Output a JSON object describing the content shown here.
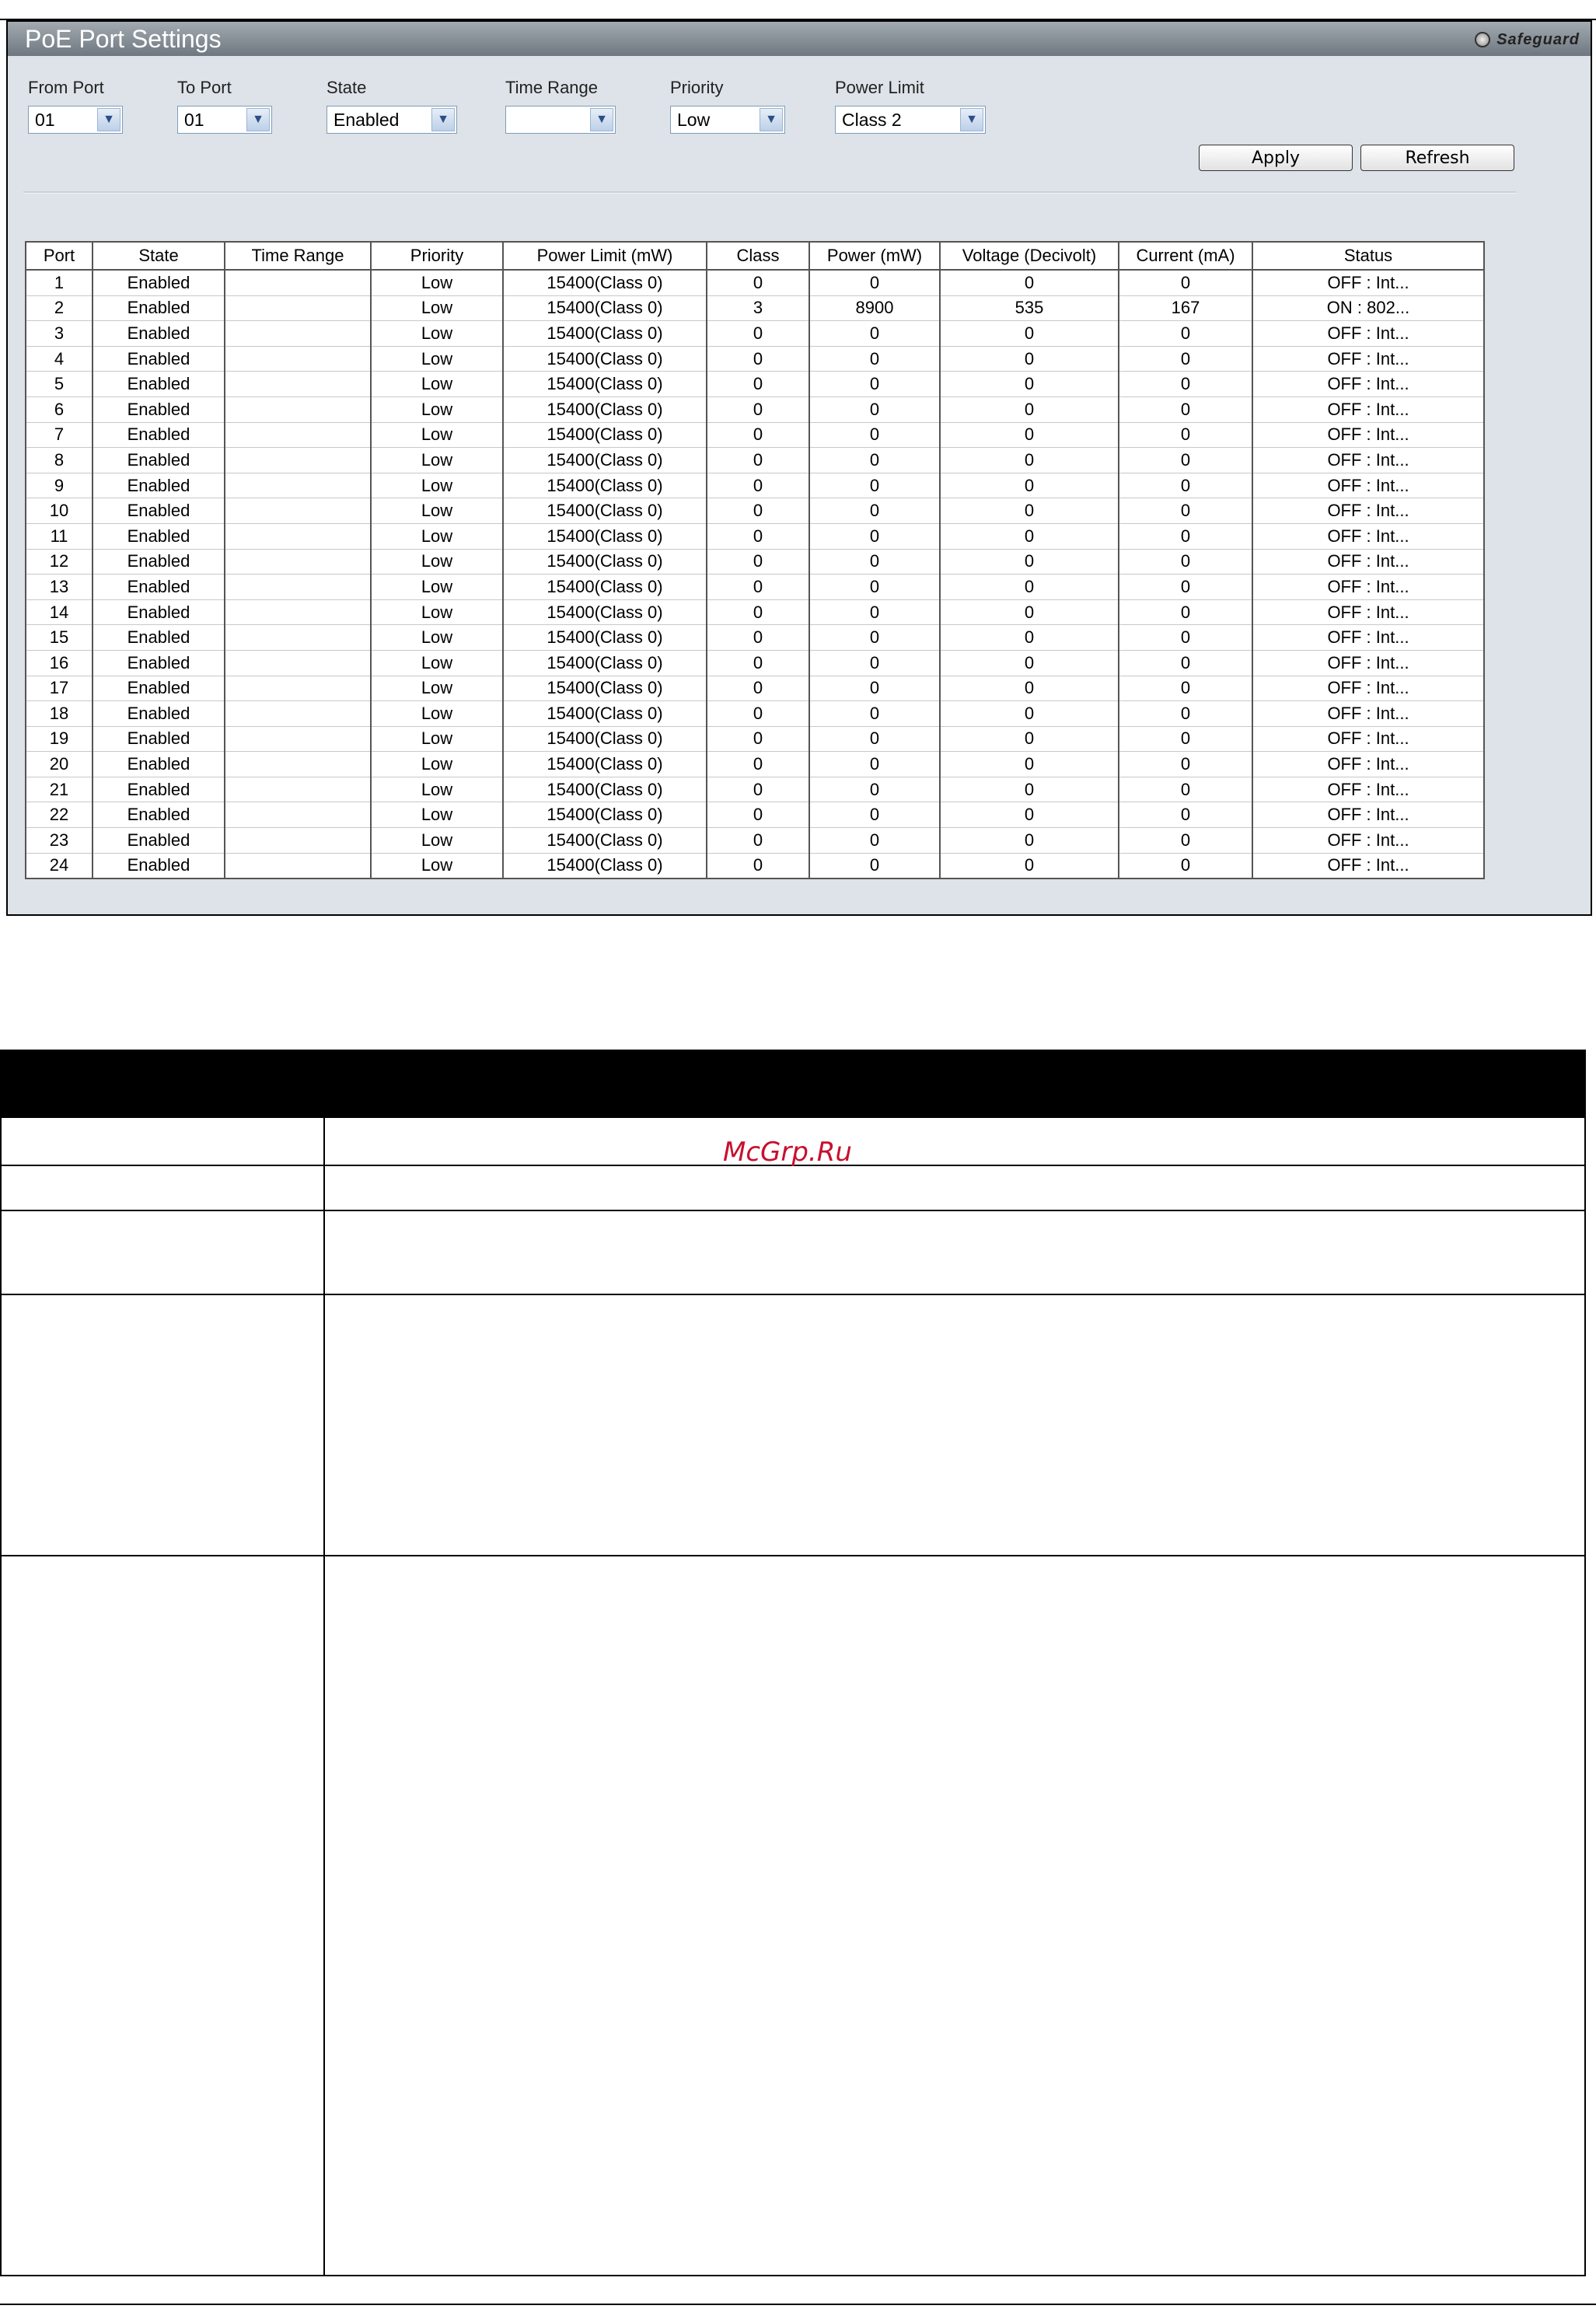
{
  "window": {
    "title": "PoE Port Settings",
    "badge": "Safeguard"
  },
  "form": {
    "from_port": {
      "label": "From Port",
      "value": "01"
    },
    "to_port": {
      "label": "To Port",
      "value": "01"
    },
    "state": {
      "label": "State",
      "value": "Enabled"
    },
    "time_range": {
      "label": "Time Range",
      "value": ""
    },
    "priority": {
      "label": "Priority",
      "value": "Low"
    },
    "power_limit": {
      "label": "Power Limit",
      "value": "Class 2"
    },
    "apply_label": "Apply",
    "refresh_label": "Refresh"
  },
  "table": {
    "headers": [
      "Port",
      "State",
      "Time Range",
      "Priority",
      "Power Limit (mW)",
      "Class",
      "Power (mW)",
      "Voltage (Decivolt)",
      "Current (mA)",
      "Status"
    ],
    "rows": [
      [
        "1",
        "Enabled",
        "",
        "Low",
        "15400(Class 0)",
        "0",
        "0",
        "0",
        "0",
        "OFF : Int..."
      ],
      [
        "2",
        "Enabled",
        "",
        "Low",
        "15400(Class 0)",
        "3",
        "8900",
        "535",
        "167",
        "ON : 802..."
      ],
      [
        "3",
        "Enabled",
        "",
        "Low",
        "15400(Class 0)",
        "0",
        "0",
        "0",
        "0",
        "OFF : Int..."
      ],
      [
        "4",
        "Enabled",
        "",
        "Low",
        "15400(Class 0)",
        "0",
        "0",
        "0",
        "0",
        "OFF : Int..."
      ],
      [
        "5",
        "Enabled",
        "",
        "Low",
        "15400(Class 0)",
        "0",
        "0",
        "0",
        "0",
        "OFF : Int..."
      ],
      [
        "6",
        "Enabled",
        "",
        "Low",
        "15400(Class 0)",
        "0",
        "0",
        "0",
        "0",
        "OFF : Int..."
      ],
      [
        "7",
        "Enabled",
        "",
        "Low",
        "15400(Class 0)",
        "0",
        "0",
        "0",
        "0",
        "OFF : Int..."
      ],
      [
        "8",
        "Enabled",
        "",
        "Low",
        "15400(Class 0)",
        "0",
        "0",
        "0",
        "0",
        "OFF : Int..."
      ],
      [
        "9",
        "Enabled",
        "",
        "Low",
        "15400(Class 0)",
        "0",
        "0",
        "0",
        "0",
        "OFF : Int..."
      ],
      [
        "10",
        "Enabled",
        "",
        "Low",
        "15400(Class 0)",
        "0",
        "0",
        "0",
        "0",
        "OFF : Int..."
      ],
      [
        "11",
        "Enabled",
        "",
        "Low",
        "15400(Class 0)",
        "0",
        "0",
        "0",
        "0",
        "OFF : Int..."
      ],
      [
        "12",
        "Enabled",
        "",
        "Low",
        "15400(Class 0)",
        "0",
        "0",
        "0",
        "0",
        "OFF : Int..."
      ],
      [
        "13",
        "Enabled",
        "",
        "Low",
        "15400(Class 0)",
        "0",
        "0",
        "0",
        "0",
        "OFF : Int..."
      ],
      [
        "14",
        "Enabled",
        "",
        "Low",
        "15400(Class 0)",
        "0",
        "0",
        "0",
        "0",
        "OFF : Int..."
      ],
      [
        "15",
        "Enabled",
        "",
        "Low",
        "15400(Class 0)",
        "0",
        "0",
        "0",
        "0",
        "OFF : Int..."
      ],
      [
        "16",
        "Enabled",
        "",
        "Low",
        "15400(Class 0)",
        "0",
        "0",
        "0",
        "0",
        "OFF : Int..."
      ],
      [
        "17",
        "Enabled",
        "",
        "Low",
        "15400(Class 0)",
        "0",
        "0",
        "0",
        "0",
        "OFF : Int..."
      ],
      [
        "18",
        "Enabled",
        "",
        "Low",
        "15400(Class 0)",
        "0",
        "0",
        "0",
        "0",
        "OFF : Int..."
      ],
      [
        "19",
        "Enabled",
        "",
        "Low",
        "15400(Class 0)",
        "0",
        "0",
        "0",
        "0",
        "OFF : Int..."
      ],
      [
        "20",
        "Enabled",
        "",
        "Low",
        "15400(Class 0)",
        "0",
        "0",
        "0",
        "0",
        "OFF : Int..."
      ],
      [
        "21",
        "Enabled",
        "",
        "Low",
        "15400(Class 0)",
        "0",
        "0",
        "0",
        "0",
        "OFF : Int..."
      ],
      [
        "22",
        "Enabled",
        "",
        "Low",
        "15400(Class 0)",
        "0",
        "0",
        "0",
        "0",
        "OFF : Int..."
      ],
      [
        "23",
        "Enabled",
        "",
        "Low",
        "15400(Class 0)",
        "0",
        "0",
        "0",
        "0",
        "OFF : Int..."
      ],
      [
        "24",
        "Enabled",
        "",
        "Low",
        "15400(Class 0)",
        "0",
        "0",
        "0",
        "0",
        "OFF : Int..."
      ]
    ]
  },
  "watermark": "McGrp.Ru"
}
